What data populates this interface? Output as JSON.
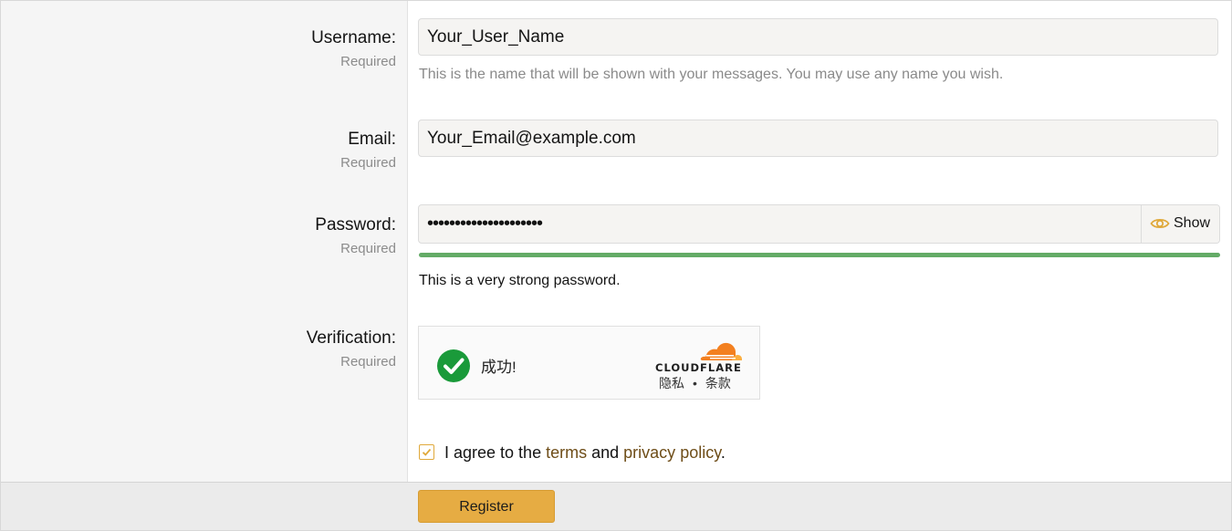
{
  "form": {
    "username": {
      "label": "Username:",
      "required": "Required",
      "value": "Your_User_Name",
      "hint": "This is the name that will be shown with your messages. You may use any name you wish."
    },
    "email": {
      "label": "Email:",
      "required": "Required",
      "value": "Your_Email@example.com"
    },
    "password": {
      "label": "Password:",
      "required": "Required",
      "masked_value": "•••••••••••••••••••••",
      "show_label": "Show",
      "strength_fraction": 1.0,
      "strength_text": "This is a very strong password."
    },
    "verification": {
      "label": "Verification:",
      "required": "Required",
      "status": "成功!",
      "provider": "CLOUDFLARE",
      "privacy": "隐私",
      "separator": "•",
      "terms": "条款"
    },
    "agree": {
      "checked": true,
      "prefix": "I agree to the",
      "terms_link": "terms",
      "and": "and",
      "privacy_link": "privacy policy",
      "suffix": "."
    },
    "register_label": "Register"
  },
  "colors": {
    "accent": "#e6ac43",
    "strength_bar": "#63ab66",
    "success": "#1a9a3a",
    "cloudflare_orange": "#f38020",
    "link": "#6e4d18"
  },
  "icons": {
    "show": "eye-icon",
    "status": "checkmark-circle-icon",
    "logo": "cloudflare-cloud-icon",
    "agree": "checkbox-checked-icon"
  }
}
